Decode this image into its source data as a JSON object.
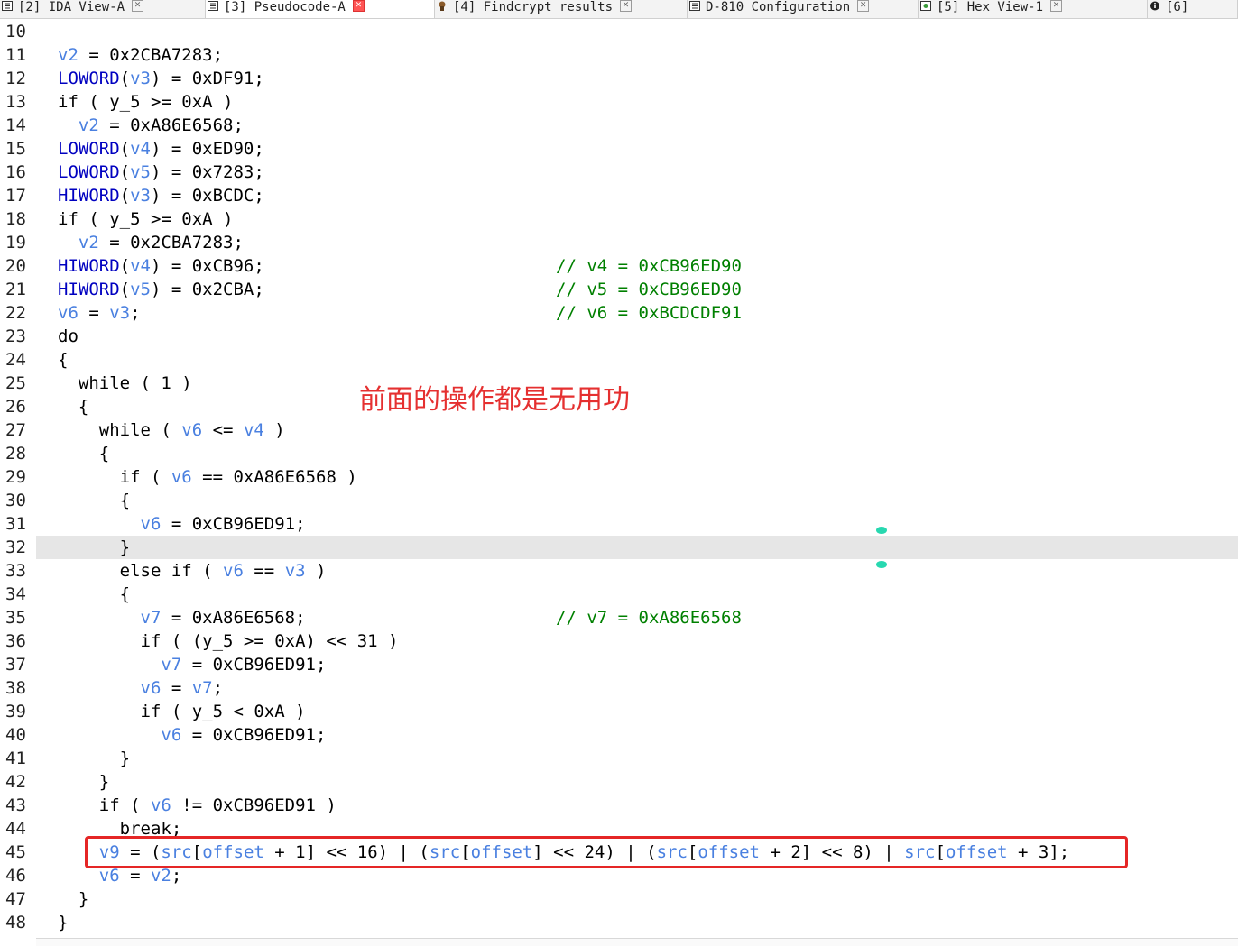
{
  "tabs": [
    {
      "num": "[2]",
      "label": "IDA View-A",
      "icon": "ida-view-icon",
      "close": "✕"
    },
    {
      "num": "[3]",
      "label": "Pseudocode-A",
      "icon": "pseudocode-icon",
      "close": "✕"
    },
    {
      "num": "[4]",
      "label": "Findcrypt results",
      "icon": "findcrypt-icon",
      "close": "✕"
    },
    {
      "num": "",
      "label": "D-810 Configuration",
      "icon": "config-icon",
      "close": "✕"
    },
    {
      "num": "[5]",
      "label": "Hex View-1",
      "icon": "hex-view-icon",
      "close": "✕"
    },
    {
      "num": "[6]",
      "label": "",
      "icon": "info-icon",
      "close": ""
    }
  ],
  "code_lines": [
    {
      "n": "10",
      "segs": []
    },
    {
      "n": "11",
      "segs": [
        [
          "v",
          "v2"
        ],
        [
          "t",
          " = 0x2CBA7283;"
        ]
      ]
    },
    {
      "n": "12",
      "segs": [
        [
          "fn",
          "LOWORD"
        ],
        [
          "t",
          "("
        ],
        [
          "v",
          "v3"
        ],
        [
          "t",
          ") = 0xDF91;"
        ]
      ]
    },
    {
      "n": "13",
      "segs": [
        [
          "t",
          "if ( y_5 >= 0xA )"
        ]
      ]
    },
    {
      "n": "14",
      "segs": [
        [
          "t",
          "  "
        ],
        [
          "v",
          "v2"
        ],
        [
          "t",
          " = 0xA86E6568;"
        ]
      ]
    },
    {
      "n": "15",
      "segs": [
        [
          "fn",
          "LOWORD"
        ],
        [
          "t",
          "("
        ],
        [
          "v",
          "v4"
        ],
        [
          "t",
          ") = 0xED90;"
        ]
      ]
    },
    {
      "n": "16",
      "segs": [
        [
          "fn",
          "LOWORD"
        ],
        [
          "t",
          "("
        ],
        [
          "v",
          "v5"
        ],
        [
          "t",
          ") = 0x7283;"
        ]
      ]
    },
    {
      "n": "17",
      "segs": [
        [
          "fn",
          "HIWORD"
        ],
        [
          "t",
          "("
        ],
        [
          "v",
          "v3"
        ],
        [
          "t",
          ") = 0xBCDC;"
        ]
      ]
    },
    {
      "n": "18",
      "segs": [
        [
          "t",
          "if ( y_5 >= 0xA )"
        ]
      ]
    },
    {
      "n": "19",
      "segs": [
        [
          "t",
          "  "
        ],
        [
          "v",
          "v2"
        ],
        [
          "t",
          " = 0x2CBA7283;"
        ]
      ]
    },
    {
      "n": "20",
      "segs": [
        [
          "fn",
          "HIWORD"
        ],
        [
          "t",
          "("
        ],
        [
          "v",
          "v4"
        ],
        [
          "t",
          ") = 0xCB96;"
        ]
      ],
      "comment": "// v4 = 0xCB96ED90"
    },
    {
      "n": "21",
      "segs": [
        [
          "fn",
          "HIWORD"
        ],
        [
          "t",
          "("
        ],
        [
          "v",
          "v5"
        ],
        [
          "t",
          ") = 0x2CBA;"
        ]
      ],
      "comment": "// v5 = 0xCB96ED90"
    },
    {
      "n": "22",
      "segs": [
        [
          "v",
          "v6"
        ],
        [
          "t",
          " = "
        ],
        [
          "v",
          "v3"
        ],
        [
          "t",
          ";"
        ]
      ],
      "comment": "// v6 = 0xBCDCDF91"
    },
    {
      "n": "23",
      "segs": [
        [
          "t",
          "do"
        ]
      ]
    },
    {
      "n": "24",
      "segs": [
        [
          "t",
          "{"
        ]
      ]
    },
    {
      "n": "25",
      "segs": [
        [
          "t",
          "  while ( 1 )"
        ]
      ]
    },
    {
      "n": "26",
      "segs": [
        [
          "t",
          "  {"
        ]
      ]
    },
    {
      "n": "27",
      "segs": [
        [
          "t",
          "    while ( "
        ],
        [
          "v",
          "v6"
        ],
        [
          "t",
          " <= "
        ],
        [
          "v",
          "v4"
        ],
        [
          "t",
          " )"
        ]
      ]
    },
    {
      "n": "28",
      "segs": [
        [
          "t",
          "    {"
        ]
      ]
    },
    {
      "n": "29",
      "segs": [
        [
          "t",
          "      if ( "
        ],
        [
          "v",
          "v6"
        ],
        [
          "t",
          " == 0xA86E6568 )"
        ]
      ]
    },
    {
      "n": "30",
      "segs": [
        [
          "t",
          "      {"
        ]
      ]
    },
    {
      "n": "31",
      "segs": [
        [
          "t",
          "        "
        ],
        [
          "v",
          "v6"
        ],
        [
          "t",
          " = 0xCB96ED91;"
        ]
      ]
    },
    {
      "n": "32",
      "segs": [
        [
          "t",
          "      }"
        ]
      ],
      "highlight": true
    },
    {
      "n": "33",
      "segs": [
        [
          "t",
          "      else if ( "
        ],
        [
          "v",
          "v6"
        ],
        [
          "t",
          " == "
        ],
        [
          "v",
          "v3"
        ],
        [
          "t",
          " )"
        ]
      ]
    },
    {
      "n": "34",
      "segs": [
        [
          "t",
          "      {"
        ]
      ]
    },
    {
      "n": "35",
      "segs": [
        [
          "t",
          "        "
        ],
        [
          "v",
          "v7"
        ],
        [
          "t",
          " = 0xA86E6568;"
        ]
      ],
      "comment": "// v7 = 0xA86E6568"
    },
    {
      "n": "36",
      "segs": [
        [
          "t",
          "        if ( (y_5 >= 0xA) << 31 )"
        ]
      ]
    },
    {
      "n": "37",
      "segs": [
        [
          "t",
          "          "
        ],
        [
          "v",
          "v7"
        ],
        [
          "t",
          " = 0xCB96ED91;"
        ]
      ]
    },
    {
      "n": "38",
      "segs": [
        [
          "t",
          "        "
        ],
        [
          "v",
          "v6"
        ],
        [
          "t",
          " = "
        ],
        [
          "v",
          "v7"
        ],
        [
          "t",
          ";"
        ]
      ]
    },
    {
      "n": "39",
      "segs": [
        [
          "t",
          "        if ( y_5 < 0xA )"
        ]
      ]
    },
    {
      "n": "40",
      "segs": [
        [
          "t",
          "          "
        ],
        [
          "v",
          "v6"
        ],
        [
          "t",
          " = 0xCB96ED91;"
        ]
      ]
    },
    {
      "n": "41",
      "segs": [
        [
          "t",
          "      }"
        ]
      ]
    },
    {
      "n": "42",
      "segs": [
        [
          "t",
          "    }"
        ]
      ]
    },
    {
      "n": "43",
      "segs": [
        [
          "t",
          "    if ( "
        ],
        [
          "v",
          "v6"
        ],
        [
          "t",
          " != 0xCB96ED91 )"
        ]
      ]
    },
    {
      "n": "44",
      "segs": [
        [
          "t",
          "      break;"
        ]
      ]
    },
    {
      "n": "45",
      "segs": [
        [
          "t",
          "    "
        ],
        [
          "v",
          "v9"
        ],
        [
          "t",
          " = ("
        ],
        [
          "v",
          "src"
        ],
        [
          "t",
          "["
        ],
        [
          "v",
          "offset"
        ],
        [
          "t",
          " + 1] << 16) | ("
        ],
        [
          "v",
          "src"
        ],
        [
          "t",
          "["
        ],
        [
          "v",
          "offset"
        ],
        [
          "t",
          "] << 24) | ("
        ],
        [
          "v",
          "src"
        ],
        [
          "t",
          "["
        ],
        [
          "v",
          "offset"
        ],
        [
          "t",
          " + 2] << 8) | "
        ],
        [
          "v",
          "src"
        ],
        [
          "t",
          "["
        ],
        [
          "v",
          "offset"
        ],
        [
          "t",
          " + 3];"
        ]
      ]
    },
    {
      "n": "46",
      "segs": [
        [
          "t",
          "    "
        ],
        [
          "v",
          "v6"
        ],
        [
          "t",
          " = "
        ],
        [
          "v",
          "v2"
        ],
        [
          "t",
          ";"
        ]
      ]
    },
    {
      "n": "47",
      "segs": [
        [
          "t",
          "  }"
        ]
      ]
    },
    {
      "n": "48",
      "segs": [
        [
          "t",
          "}"
        ]
      ]
    }
  ],
  "annotation": {
    "text": "前面的操作都是无用功",
    "color": "#e53030",
    "box_color": "#e52626"
  },
  "colors": {
    "variable": "#4a80e0",
    "function": "#0000c0",
    "comment": "#008000",
    "current_line": "#e6e6e6",
    "marker": "#28d8b0"
  }
}
